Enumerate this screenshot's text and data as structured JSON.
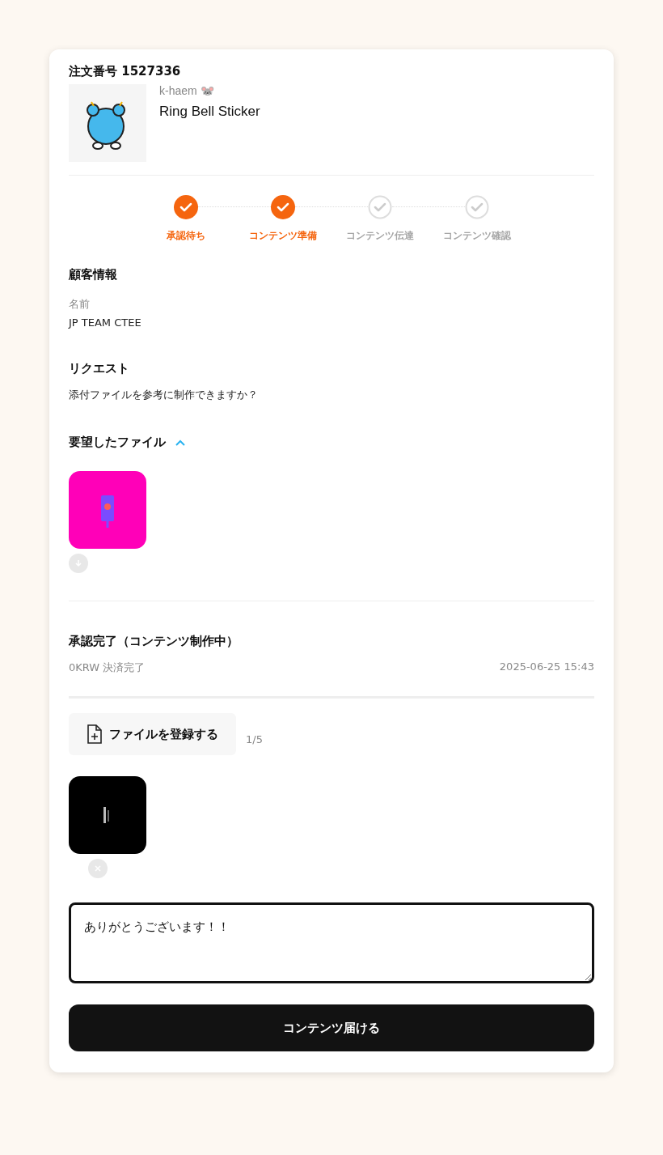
{
  "order": {
    "title": "注文番号 1527336",
    "seller": "k-haem 🐭",
    "product": "Ring Bell Sticker"
  },
  "steps": [
    {
      "label": "承認待ち",
      "done": true
    },
    {
      "label": "コンテンツ準備",
      "done": true
    },
    {
      "label": "コンテンツ伝達",
      "done": false
    },
    {
      "label": "コンテンツ確認",
      "done": false
    }
  ],
  "customer": {
    "heading": "顧客情報",
    "name_label": "名前",
    "name": "JP TEAM CTEE"
  },
  "request": {
    "heading": "リクエスト",
    "text": "添付ファイルを参考に制作できますか？"
  },
  "requested_files": {
    "heading": "要望したファイル",
    "expanded": true
  },
  "status": {
    "title": "承認完了（コンテンツ制作中）",
    "payment": "0KRW 決済完了",
    "date": "2025-06-25 15:43"
  },
  "upload": {
    "button": "ファイルを登録する",
    "count": "1/5"
  },
  "message": {
    "value": "ありがとうございます！！"
  },
  "submit": "コンテンツ届ける"
}
